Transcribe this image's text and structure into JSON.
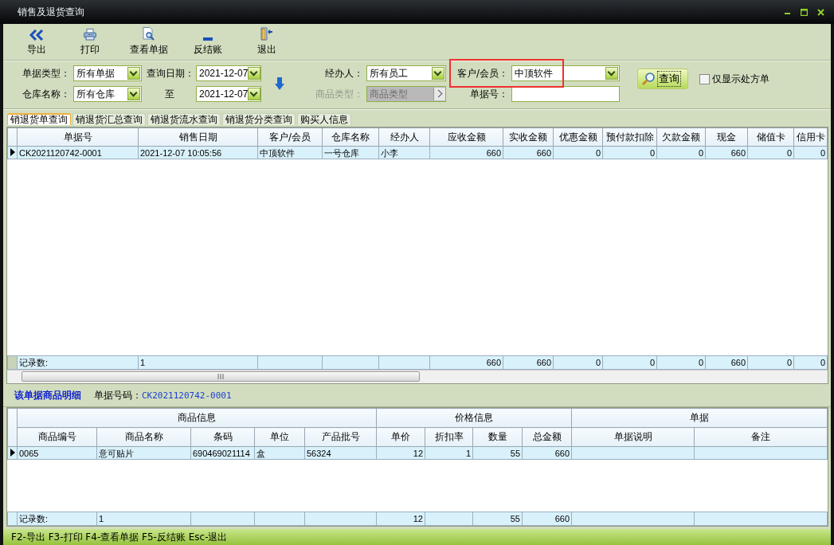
{
  "window": {
    "title": "销售及退货查询"
  },
  "toolbar": [
    {
      "label": "导出",
      "kind": "export"
    },
    {
      "label": "打印",
      "kind": "print"
    },
    {
      "label": "查看单据",
      "kind": "view"
    },
    {
      "label": "反结账",
      "kind": "unpost"
    },
    {
      "label": "退出",
      "kind": "exit"
    }
  ],
  "filters": {
    "doc_type": {
      "label": "单据类型：",
      "value": "所有单据"
    },
    "date_from": {
      "label": "查询日期：",
      "value": "2021-12-07"
    },
    "handler": {
      "label": "经办人：",
      "value": "所有员工"
    },
    "customer": {
      "label": "客户/会员：",
      "value": "中顶软件",
      "highlighted": true
    },
    "warehouse": {
      "label": "仓库名称：",
      "value": "所有仓库"
    },
    "date_to": {
      "label": "至",
      "value": "2021-12-07"
    },
    "product_type": {
      "label": "商品类型：",
      "value": "商品类型",
      "disabled": true
    },
    "doc_no": {
      "label": "单据号："
    }
  },
  "query_button": {
    "label": "查询"
  },
  "prescription_only": {
    "label": "仅显示处方单",
    "checked": false
  },
  "tabs": [
    {
      "label": "销退货单查询",
      "selected": true
    },
    {
      "label": "销退货汇总查询",
      "selected": false
    },
    {
      "label": "销退货流水查询",
      "selected": false
    },
    {
      "label": "销退货分类查询",
      "selected": false
    },
    {
      "label": "购买人信息",
      "selected": false
    }
  ],
  "sales_table": {
    "columns": [
      "单据号",
      "销售日期",
      "客户/会员",
      "仓库名称",
      "经办人",
      "应收金额",
      "实收金额",
      "优惠金额",
      "预付款扣除",
      "欠款金额",
      "现金",
      "储值卡",
      "信用卡"
    ],
    "rows": [
      {
        "selected": true,
        "cells": [
          "CK2021120742-0001",
          "2021-12-07 10:05:56",
          "中顶软件",
          "一号仓库",
          "小李",
          "660",
          "660",
          "0",
          "0",
          "0",
          "660",
          "0",
          "0"
        ]
      }
    ],
    "footer": {
      "label": "记录数:",
      "count": "1",
      "totals": [
        "660",
        "660",
        "0",
        "0",
        "0",
        "660",
        "0",
        "0"
      ]
    }
  },
  "detail": {
    "title": "该单据商品明细",
    "doc_label": "单据号码：",
    "doc_no": "CK2021120742-0001",
    "groups": [
      {
        "label": "商品信息",
        "columns": [
          "商品编号",
          "商品名称",
          "条码",
          "单位",
          "产品批号"
        ]
      },
      {
        "label": "价格信息",
        "columns": [
          {
            "label": "单价",
            "total": "12"
          },
          {
            "label": "折扣率"
          },
          {
            "label": "数量",
            "total": "55"
          },
          {
            "label": "总金额",
            "total": "660"
          }
        ]
      },
      {
        "label": "单据",
        "columns": [
          "单据说明",
          "备注"
        ]
      }
    ],
    "rows": [
      {
        "selected": true,
        "cells": [
          "0065",
          "意可贴片",
          "690469021114",
          "盒",
          "56324",
          "12",
          "1",
          "55",
          "660"
        ]
      }
    ],
    "footer": {
      "label": "记录数:",
      "count": "1"
    }
  },
  "status_bar": "F2-导出 F3-打印 F4-查看单据 F5-反结账 Esc-退出"
}
